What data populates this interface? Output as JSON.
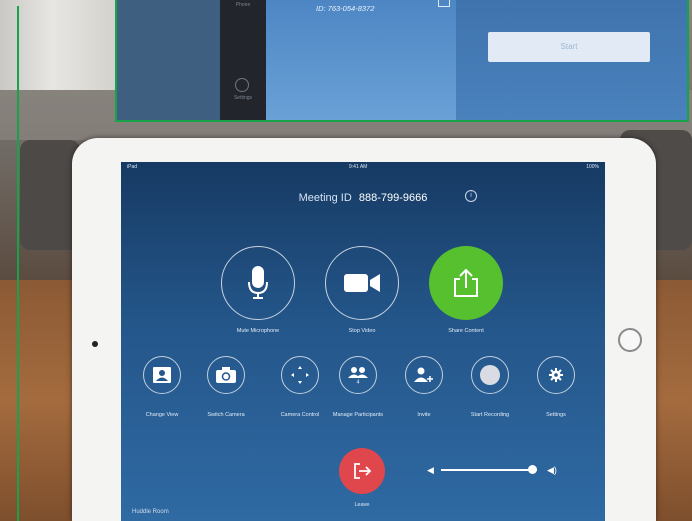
{
  "inset": {
    "sidebar_top_label": "Phone",
    "sidebar_settings_label": "Settings",
    "meeting_id_text": "ID: 763-054-8372",
    "start_button": "Start"
  },
  "tablet": {
    "status": {
      "carrier": "iPad",
      "time": "9:41 AM",
      "battery": "100%"
    },
    "meeting_id_label": "Meeting ID",
    "meeting_id_value": "888-799-9666",
    "primary_actions": [
      {
        "label": "Mute Microphone",
        "icon": "microphone-icon"
      },
      {
        "label": "Stop Video",
        "icon": "video-camera-icon"
      },
      {
        "label": "Share Content",
        "icon": "share-upload-icon"
      }
    ],
    "secondary_actions": [
      {
        "label": "Change View",
        "icon": "change-view-icon"
      },
      {
        "label": "Switch Camera",
        "icon": "switch-camera-icon"
      },
      {
        "label": "Camera Control",
        "icon": "camera-control-icon"
      },
      {
        "label": "Manage Participants",
        "icon": "participants-icon",
        "badge": "4"
      },
      {
        "label": "Invite",
        "icon": "invite-icon"
      },
      {
        "label": "Start Recording",
        "icon": "record-icon"
      },
      {
        "label": "Settings",
        "icon": "gear-icon"
      }
    ],
    "leave_label": "Leave",
    "room_name": "Huddle Room",
    "volume_level": 0.95
  },
  "colors": {
    "share_green": "#57c02f",
    "leave_red": "#e0474c",
    "screen_blue": "#24568a",
    "frame_green": "#18a34a"
  }
}
